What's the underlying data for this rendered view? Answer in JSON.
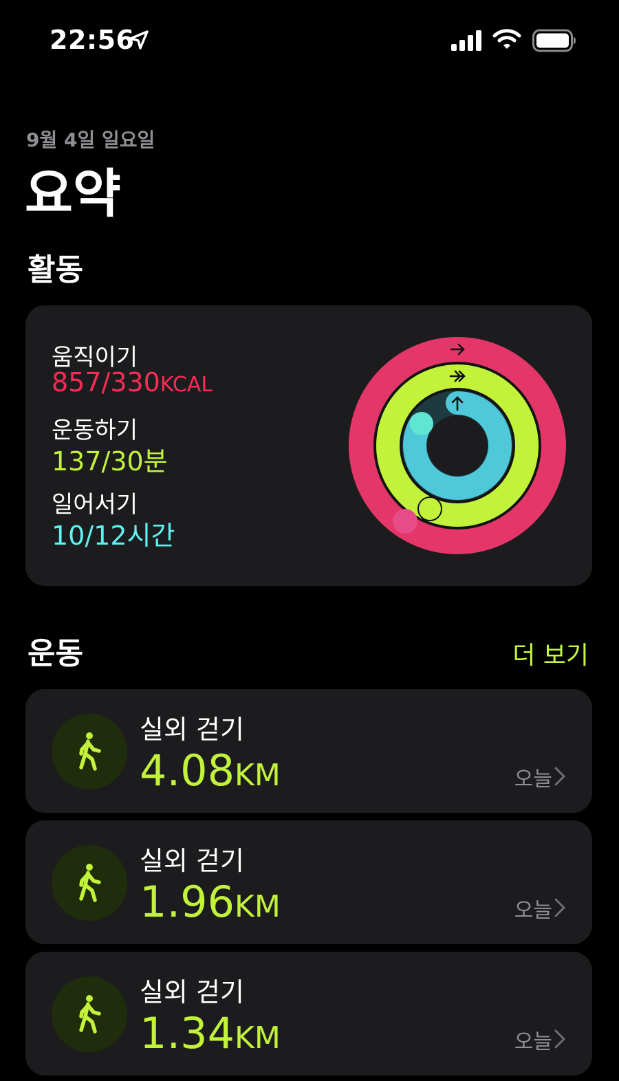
{
  "status_bar": {
    "time": "22:56"
  },
  "header": {
    "date": "9월 4일 일요일",
    "title": "요약"
  },
  "activity": {
    "section_title": "활동",
    "move": {
      "label": "움직이기",
      "value": "857/330",
      "unit": "KCAL",
      "progress": 2.597,
      "color": "#fa2c55"
    },
    "exercise": {
      "label": "운동하기",
      "value": "137/30분",
      "progress": 4.567,
      "color": "#c2f23a"
    },
    "stand": {
      "label": "일어서기",
      "value": "10/12시간",
      "progress": 0.833,
      "color": "#5ff2f2"
    }
  },
  "workouts": {
    "section_title": "운동",
    "more_label": "더 보기",
    "items": [
      {
        "name": "실외 걷기",
        "distance": "4.08",
        "unit": "KM",
        "date": "오늘"
      },
      {
        "name": "실외 걷기",
        "distance": "1.96",
        "unit": "KM",
        "date": "오늘"
      },
      {
        "name": "실외 걷기",
        "distance": "1.34",
        "unit": "KM",
        "date": "오늘"
      }
    ]
  }
}
